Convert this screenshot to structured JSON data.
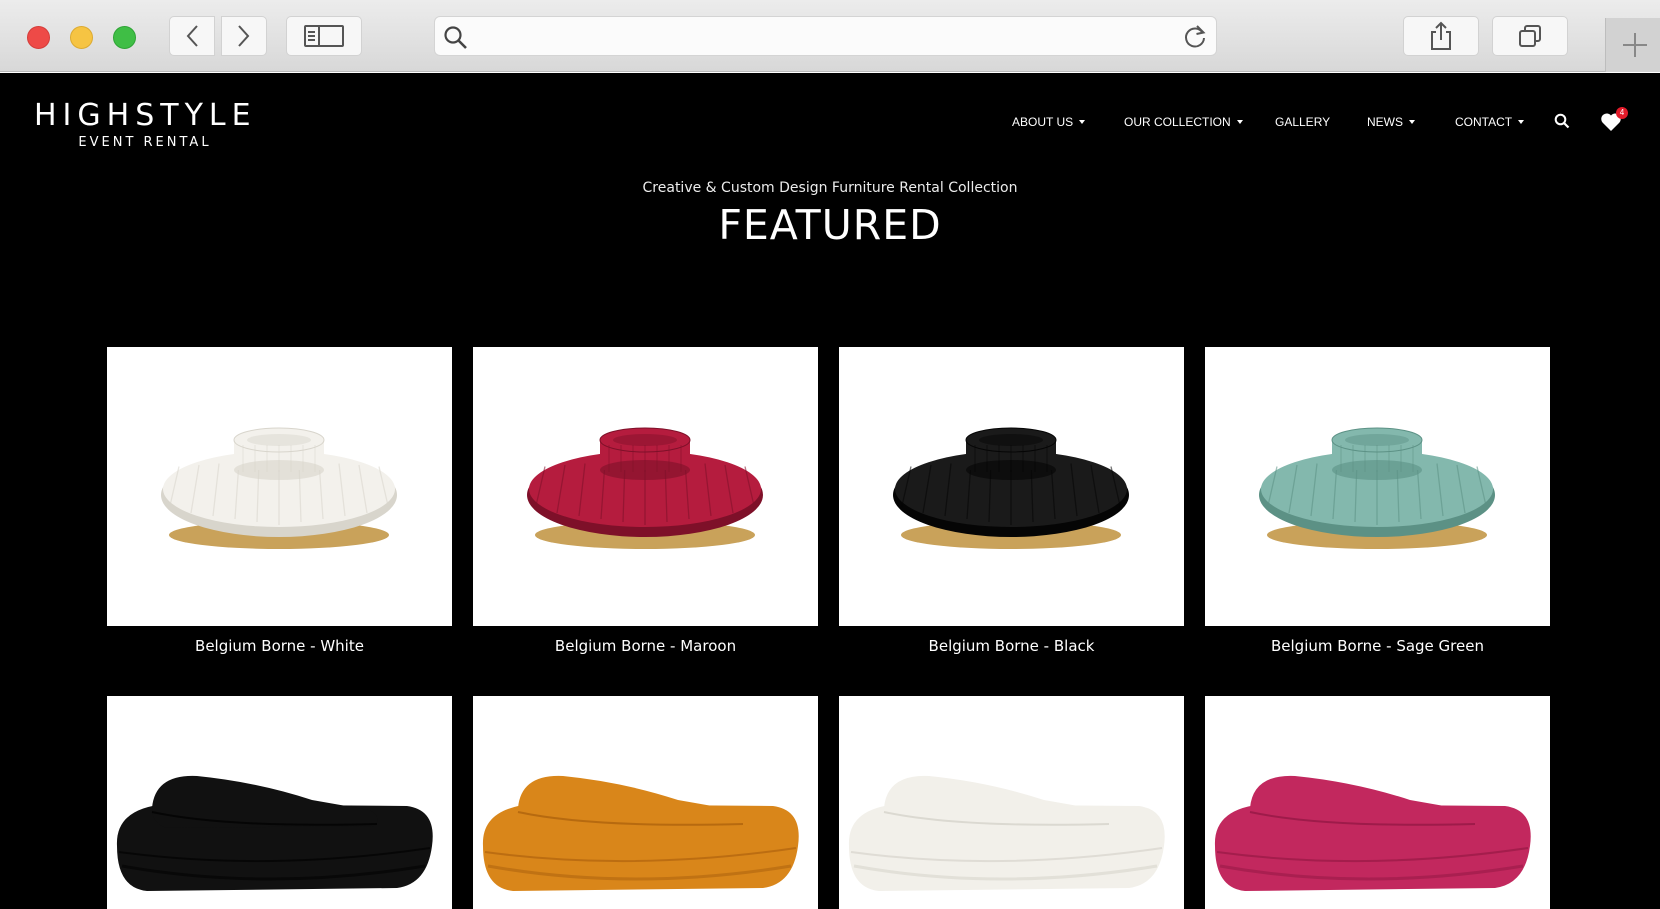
{
  "browser": {
    "address_value": "",
    "icons": {
      "back": "chevron-left-icon",
      "forward": "chevron-right-icon",
      "sidebar": "sidebar-icon",
      "search": "search-icon",
      "reload": "reload-icon",
      "share": "share-icon",
      "tabs": "tabs-icon",
      "new_tab": "plus-icon"
    }
  },
  "site": {
    "logo": {
      "main": "HIGHSTYLE",
      "sub": "EVENT RENTAL"
    },
    "nav": {
      "about": "ABOUT US",
      "collection": "OUR COLLECTION",
      "gallery": "GALLERY",
      "news": "NEWS",
      "contact": "CONTACT"
    },
    "favorites_count": "4",
    "hero": {
      "subtitle": "Creative & Custom Design Furniture Rental Collection",
      "title": "FEATURED"
    },
    "products": [
      {
        "name": "Belgium Borne - White",
        "color": "#f3f1ec",
        "shade": "#d8d5cc",
        "type": "round-ottoman"
      },
      {
        "name": "Belgium Borne - Maroon",
        "color": "#b51c3e",
        "shade": "#7e1029",
        "type": "round-ottoman"
      },
      {
        "name": "Belgium Borne - Black",
        "color": "#1a1a1a",
        "shade": "#050505",
        "type": "round-ottoman"
      },
      {
        "name": "Belgium Borne - Sage Green",
        "color": "#83b8ad",
        "shade": "#5c9185",
        "type": "round-ottoman"
      },
      {
        "color": "#111111",
        "shade": "#000000",
        "type": "curved-sofa"
      },
      {
        "color": "#d9861a",
        "shade": "#a85e0c",
        "type": "curved-sofa"
      },
      {
        "color": "#f2f0ea",
        "shade": "#d2cfc6",
        "type": "curved-sofa"
      },
      {
        "color": "#c2285e",
        "shade": "#8f1641",
        "type": "curved-sofa"
      }
    ]
  }
}
